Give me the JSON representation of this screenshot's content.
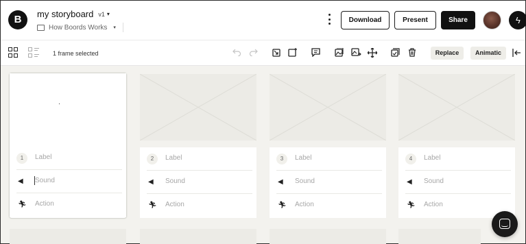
{
  "header": {
    "logo_letter": "B",
    "title": "my storyboard",
    "version": "v1",
    "project_name": "How Boords Works",
    "buttons": {
      "download": "Download",
      "present": "Present",
      "share": "Share"
    }
  },
  "toolbar": {
    "selection_text": "1 frame selected",
    "replace_label": "Replace",
    "animatic_label": "Animatic"
  },
  "frames": [
    {
      "number": "1",
      "label": "Label",
      "sound": "Sound",
      "action": "Action",
      "selected": true
    },
    {
      "number": "2",
      "label": "Label",
      "sound": "Sound",
      "action": "Action",
      "selected": false
    },
    {
      "number": "3",
      "label": "Label",
      "sound": "Sound",
      "action": "Action",
      "selected": false
    },
    {
      "number": "4",
      "label": "Label",
      "sound": "Sound",
      "action": "Action",
      "selected": false
    }
  ],
  "icons": {
    "logo": "boords-logo-icon",
    "folder": "folder-icon",
    "more": "kebab-menu-icon",
    "bolt": "lightning-bolt-icon",
    "grid_view": "grid-view-icon",
    "list_view": "list-view-icon",
    "undo": "undo-icon",
    "redo": "redo-icon",
    "sound": "speaker-icon",
    "action": "running-person-icon",
    "chat": "chat-icon"
  },
  "colors": {
    "accent": "#111111",
    "canvas": "#f3f2ee",
    "placeholder": "#ecebe6"
  }
}
